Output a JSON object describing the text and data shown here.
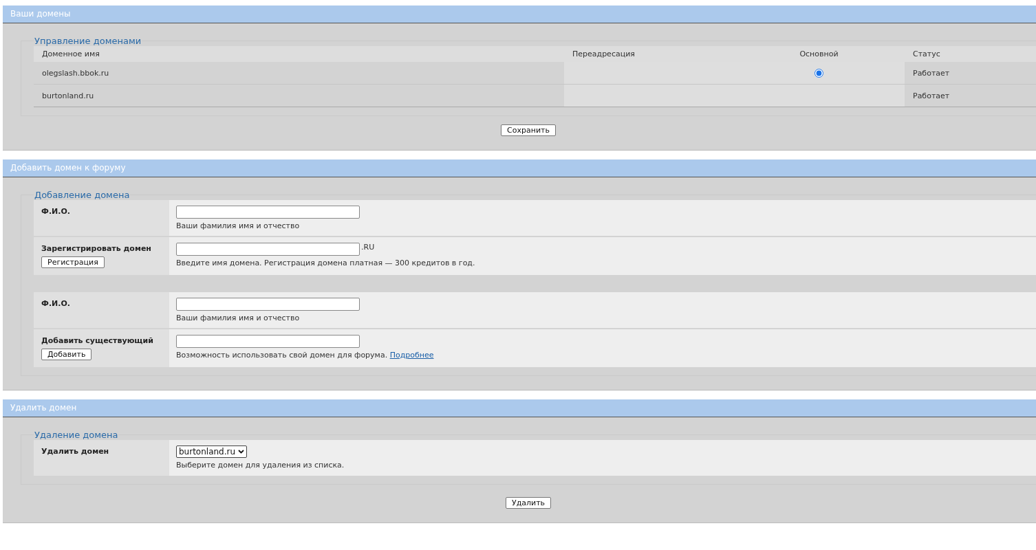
{
  "sections": [
    {
      "kind": "domains",
      "title": "Ваши домены",
      "legend": "Управление доменами",
      "columns": [
        "Доменное имя",
        "Переадресация",
        "Основной",
        "Статус"
      ],
      "rows": [
        {
          "domain": "olegslash.bbok.ru",
          "selected": true,
          "status": "Работает"
        },
        {
          "domain": "burtonland.ru",
          "selected": false,
          "status": "Работает"
        }
      ],
      "button": "Сохранить"
    },
    {
      "kind": "form",
      "title": "Добавить домен к форуму",
      "legend": "Добавление домена",
      "groups": [
        [
          {
            "kind": "text",
            "label": "Ф.И.О.",
            "hint": "Ваши фамилия имя и отчество"
          },
          {
            "kind": "text",
            "label": "Зарегистрировать домен",
            "button": "Регистрация",
            "suffix": ".RU",
            "hint": "Введите имя домена. Регистрация домена платная — 300 кредитов в год."
          }
        ],
        [
          {
            "kind": "text",
            "label": "Ф.И.О.",
            "hint": "Ваши фамилия имя и отчество"
          },
          {
            "kind": "text",
            "label": "Добавить существующий",
            "button": "Добавить",
            "hint": "Возможность использовать свой домен для форума.",
            "link": "Подробнее"
          }
        ]
      ]
    },
    {
      "kind": "form",
      "title": "Удалить домен",
      "legend": "Удаление домена",
      "groups": [
        [
          {
            "kind": "select",
            "label": "Удалить домен",
            "value": "burtonland.ru",
            "hint": "Выберите домен для удаления из списка."
          }
        ]
      ],
      "button": "Удалить"
    }
  ]
}
